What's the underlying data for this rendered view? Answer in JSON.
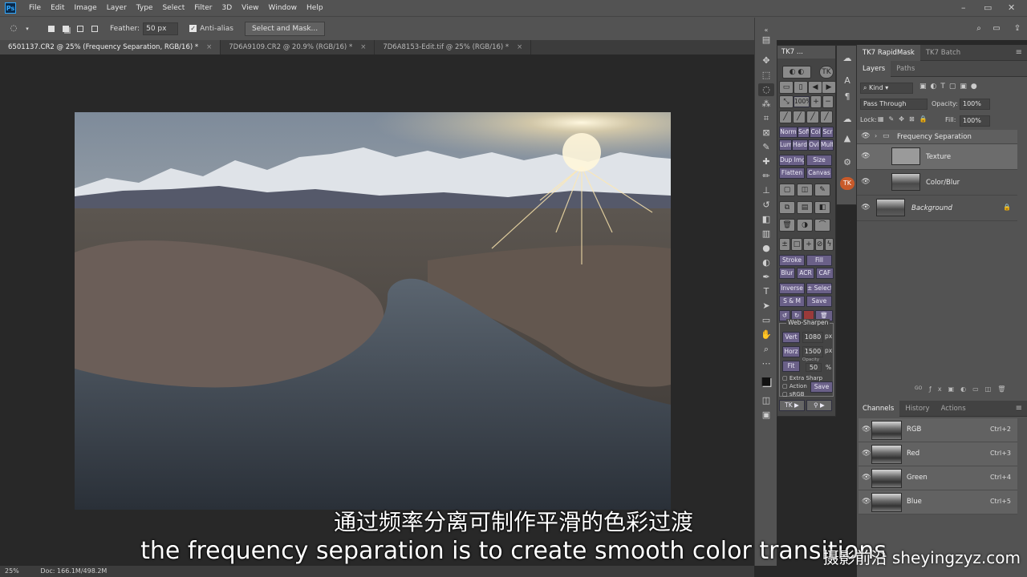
{
  "menubar": {
    "app_icon": "Ps",
    "items": [
      "File",
      "Edit",
      "Image",
      "Layer",
      "Type",
      "Select",
      "Filter",
      "3D",
      "View",
      "Window",
      "Help"
    ],
    "window_controls": [
      "–",
      "▭",
      "✕"
    ]
  },
  "options": {
    "feather_label": "Feather:",
    "feather_value": "50 px",
    "antialias_label": "Anti-alias",
    "select_mask_label": "Select and Mask..."
  },
  "tabs": [
    {
      "label": "6501137.CR2 @ 25% (Frequency Separation, RGB/16) *"
    },
    {
      "label": "7D6A9109.CR2 @ 20.9% (RGB/16) *"
    },
    {
      "label": "7D6A8153-Edit.tif @ 25% (RGB/16) *"
    }
  ],
  "status": {
    "zoom": "25%",
    "doc": "Doc: 166.1M/498.2M"
  },
  "tk7": {
    "title": "TK7 ...",
    "buttons": {
      "pct": "100%",
      "norm": "Norm",
      "soft": "Soft",
      "col": "Col",
      "scr": "Scr",
      "lum": "Lum",
      "hard": "Hard",
      "ovl": "Ovl",
      "mult": "Mult",
      "dupimg": "Dup Img",
      "size": "Size",
      "flatten": "Flatten",
      "canvas": "Canvas",
      "stroke": "Stroke",
      "fill": "Fill",
      "blur": "Blur",
      "acr": "ACR",
      "caf": "CAF",
      "inverse": "Inverse",
      "select": "± Select",
      "sam": "S & M",
      "save": "Save"
    },
    "websharpen": {
      "title": "Web-Sharpen",
      "vert_label": "Vert",
      "vert_value": "1080",
      "unit_px": "px",
      "horz_label": "Horz",
      "horz_value": "1500",
      "fit_label": "Fit",
      "opacity_label": "Opacity",
      "opacity_value": "50",
      "pct": "%",
      "extra_sharp": "Extra Sharp",
      "action": "Action",
      "srgb": "sRGB",
      "save": "Save"
    },
    "footer_tk": "TK",
    "footer_arrow": "▶"
  },
  "panel_tabs": {
    "rapidmask": "TK7 RapidMask",
    "batch": "TK7 Batch"
  },
  "layers_panel": {
    "tabs": [
      "Layers",
      "Paths"
    ],
    "kind_label": "Kind",
    "blend_mode": "Pass Through",
    "opacity_label": "Opacity:",
    "opacity_value": "100%",
    "lock_label": "Lock:",
    "fill_label": "Fill:",
    "fill_value": "100%",
    "layers": [
      {
        "name": "Frequency Separation",
        "type": "group"
      },
      {
        "name": "Texture",
        "type": "layer"
      },
      {
        "name": "Color/Blur",
        "type": "layer"
      },
      {
        "name": "Background",
        "type": "background"
      }
    ],
    "footer_link": "GO"
  },
  "channels_panel": {
    "tabs": [
      "Channels",
      "History",
      "Actions"
    ],
    "channels": [
      {
        "name": "RGB",
        "key": "Ctrl+2"
      },
      {
        "name": "Red",
        "key": "Ctrl+3"
      },
      {
        "name": "Green",
        "key": "Ctrl+4"
      },
      {
        "name": "Blue",
        "key": "Ctrl+5"
      }
    ]
  },
  "subtitles": {
    "chinese": "通过频率分离可制作平滑的色彩过渡",
    "english": "the frequency separation is to create smooth color transitions",
    "watermark": "摄影前沿 sheyingzyz.com"
  }
}
